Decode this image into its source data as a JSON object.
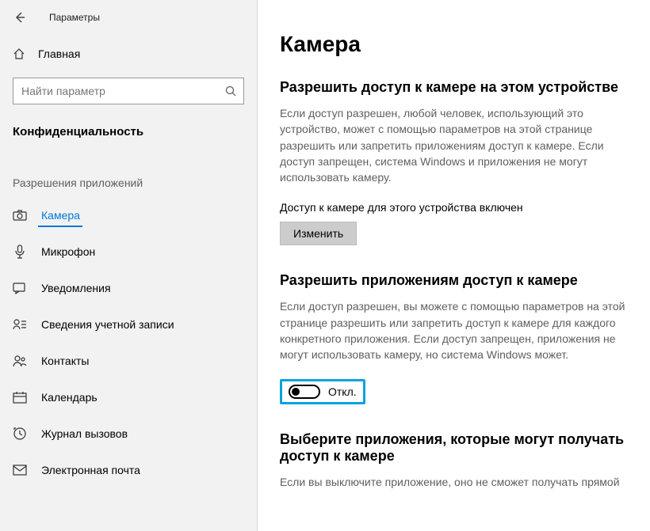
{
  "window": {
    "title": "Параметры"
  },
  "sidebar": {
    "home": "Главная",
    "search_placeholder": "Найти параметр",
    "section": "Конфиденциальность",
    "group_header": "Разрешения приложений",
    "items": [
      {
        "label": "Камера"
      },
      {
        "label": "Микрофон"
      },
      {
        "label": "Уведомления"
      },
      {
        "label": "Сведения учетной записи"
      },
      {
        "label": "Контакты"
      },
      {
        "label": "Календарь"
      },
      {
        "label": "Журнал вызовов"
      },
      {
        "label": "Электронная почта"
      }
    ]
  },
  "content": {
    "page_title": "Камера",
    "device_access": {
      "heading": "Разрешить доступ к камере на этом устройстве",
      "desc": "Если доступ разрешен, любой человек, использующий это устройство, может с помощью параметров на этой странице разрешить или запретить приложениям доступ к камере. Если доступ запрещен, система Windows и приложения не могут использовать камеру.",
      "status": "Доступ к камере для этого устройства включен",
      "change_btn": "Изменить"
    },
    "app_access": {
      "heading": "Разрешить приложениям доступ к камере",
      "desc": "Если доступ разрешен, вы можете с помощью параметров на этой странице разрешить или запретить доступ к камере для каждого конкретного приложения. Если доступ запрещен, приложения не могут использовать камеру, но система Windows может.",
      "toggle_label": "Откл."
    },
    "choose_apps": {
      "heading": "Выберите приложения, которые могут получать доступ к камере",
      "desc": "Если вы выключите приложение, оно не сможет получать прямой"
    }
  }
}
